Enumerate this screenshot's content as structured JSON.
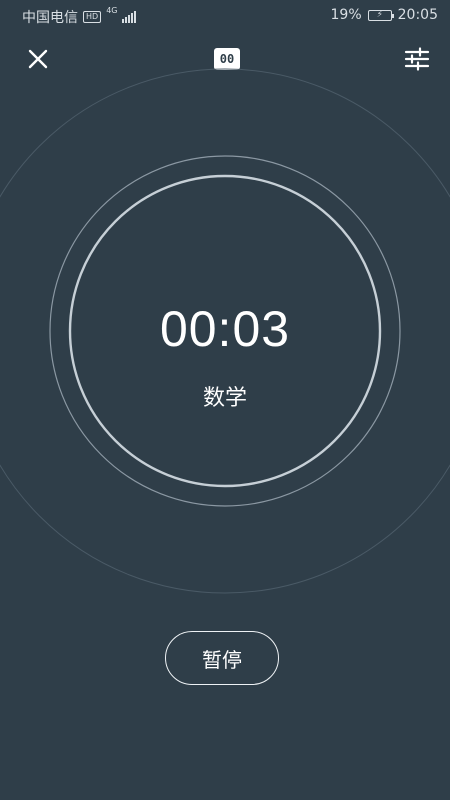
{
  "status_bar": {
    "carrier": "中国电信",
    "hd_badge": "HD",
    "network": "4G",
    "battery_percent": "19%",
    "time": "20:05"
  },
  "toolbar": {
    "close_icon": "close-icon",
    "center_badge_text": "00",
    "settings_icon": "sliders-icon"
  },
  "timer": {
    "elapsed": "00:03",
    "subject": "数学"
  },
  "controls": {
    "pause_label": "暂停"
  },
  "colors": {
    "background": "#2f3e49",
    "ring_outer": "#4a5a66",
    "ring_middle": "#8b98a3",
    "ring_inner": "#c6cfd6",
    "text": "#ffffff"
  }
}
